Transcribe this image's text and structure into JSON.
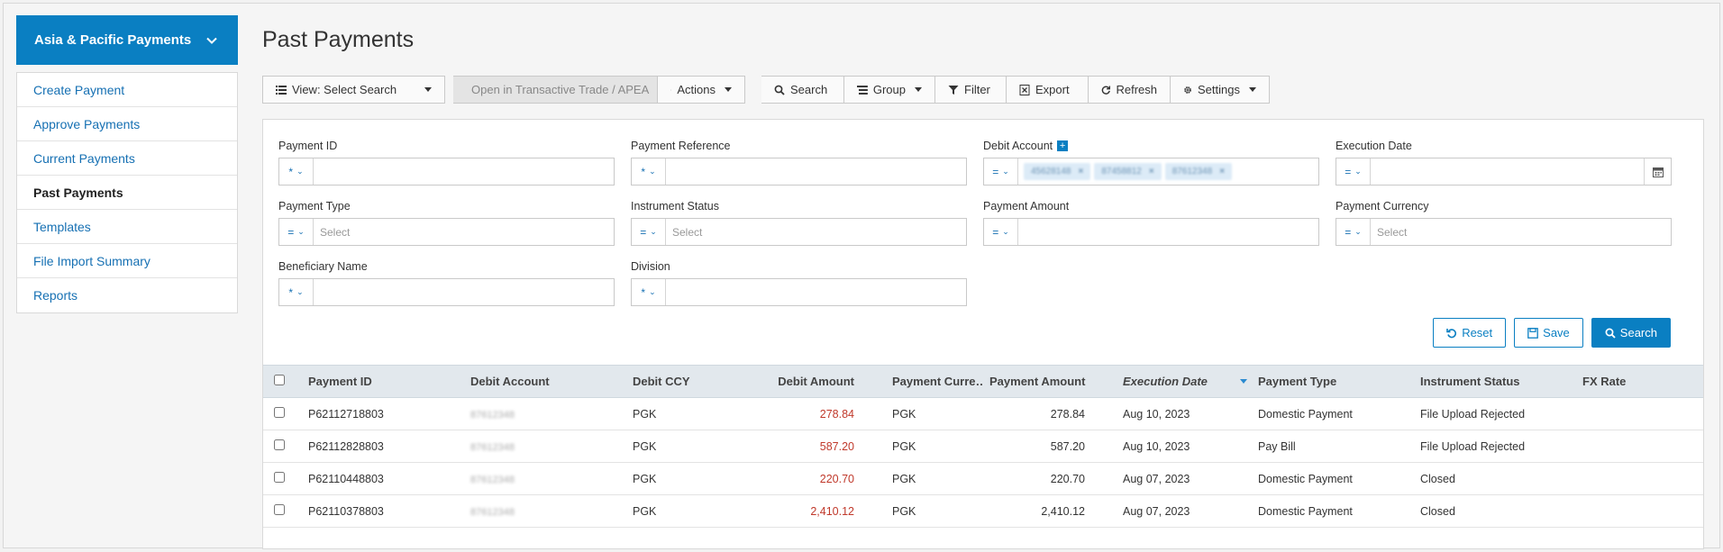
{
  "sidebar": {
    "header": "Asia & Pacific Payments",
    "items": [
      {
        "label": "Create Payment",
        "name": "sidebar-item-create-payment"
      },
      {
        "label": "Approve Payments",
        "name": "sidebar-item-approve-payments"
      },
      {
        "label": "Current Payments",
        "name": "sidebar-item-current-payments"
      },
      {
        "label": "Past Payments",
        "name": "sidebar-item-past-payments",
        "active": true
      },
      {
        "label": "Templates",
        "name": "sidebar-item-templates"
      },
      {
        "label": "File Import Summary",
        "name": "sidebar-item-file-import-summary"
      },
      {
        "label": "Reports",
        "name": "sidebar-item-reports"
      }
    ]
  },
  "page": {
    "title": "Past Payments"
  },
  "toolbar": {
    "view": "View: Select Search",
    "open": "Open in Transactive Trade / APEA",
    "actions": "Actions",
    "search": "Search",
    "group": "Group",
    "filter": "Filter",
    "export": "Export",
    "refresh": "Refresh",
    "settings": "Settings"
  },
  "form": {
    "payment_id": {
      "label": "Payment ID",
      "op": "*"
    },
    "payment_reference": {
      "label": "Payment Reference",
      "op": "*"
    },
    "debit_account": {
      "label": "Debit Account",
      "op": "=",
      "chips": [
        "45628148",
        "87458812",
        "87612348"
      ]
    },
    "execution_date": {
      "label": "Execution Date",
      "op": "="
    },
    "payment_type": {
      "label": "Payment Type",
      "op": "=",
      "placeholder": "Select"
    },
    "instrument_status": {
      "label": "Instrument Status",
      "op": "=",
      "placeholder": "Select"
    },
    "payment_amount": {
      "label": "Payment Amount",
      "op": "="
    },
    "payment_currency": {
      "label": "Payment Currency",
      "op": "=",
      "placeholder": "Select"
    },
    "beneficiary_name": {
      "label": "Beneficiary Name",
      "op": "*"
    },
    "division": {
      "label": "Division",
      "op": "*"
    },
    "reset": "Reset",
    "save": "Save",
    "search": "Search"
  },
  "table": {
    "headers": {
      "payment_id": "Payment ID",
      "debit_account": "Debit Account",
      "debit_ccy": "Debit CCY",
      "debit_amount": "Debit Amount",
      "payment_currency": "Payment Curre…",
      "payment_amount": "Payment Amount",
      "execution_date": "Execution Date",
      "payment_type": "Payment Type",
      "instrument_status": "Instrument Status",
      "fx_rate": "FX Rate"
    },
    "rows": [
      {
        "id": "P62112718803",
        "acct": "87612348",
        "ccy": "PGK",
        "damt": "278.84",
        "pccy": "PGK",
        "pamt": "278.84",
        "date": "Aug 10, 2023",
        "ptype": "Domestic Payment",
        "status": "File Upload Rejected",
        "fx": ""
      },
      {
        "id": "P62112828803",
        "acct": "87612348",
        "ccy": "PGK",
        "damt": "587.20",
        "pccy": "PGK",
        "pamt": "587.20",
        "date": "Aug 10, 2023",
        "ptype": "Pay Bill",
        "status": "File Upload Rejected",
        "fx": ""
      },
      {
        "id": "P62110448803",
        "acct": "87612348",
        "ccy": "PGK",
        "damt": "220.70",
        "pccy": "PGK",
        "pamt": "220.70",
        "date": "Aug 07, 2023",
        "ptype": "Domestic Payment",
        "status": "Closed",
        "fx": ""
      },
      {
        "id": "P62110378803",
        "acct": "87612348",
        "ccy": "PGK",
        "damt": "2,410.12",
        "pccy": "PGK",
        "pamt": "2,410.12",
        "date": "Aug 07, 2023",
        "ptype": "Domestic Payment",
        "status": "Closed",
        "fx": ""
      }
    ]
  }
}
